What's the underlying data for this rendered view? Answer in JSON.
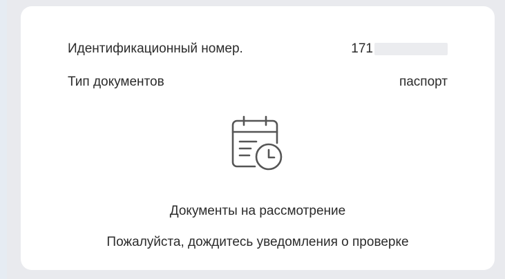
{
  "details": {
    "id_label": "Идентификационный номер.",
    "id_value": "171",
    "doc_type_label": "Тип документов",
    "doc_type_value": "паспорт"
  },
  "status": {
    "icon": "calendar-clock-icon",
    "title": "Документы на рассмотрение",
    "subtitle": "Пожалуйста, дождитесь уведомления о проверке"
  },
  "colors": {
    "background": "#e9eaee",
    "card": "#ffffff",
    "text": "#2b2b2b",
    "icon_stroke": "#555555"
  }
}
